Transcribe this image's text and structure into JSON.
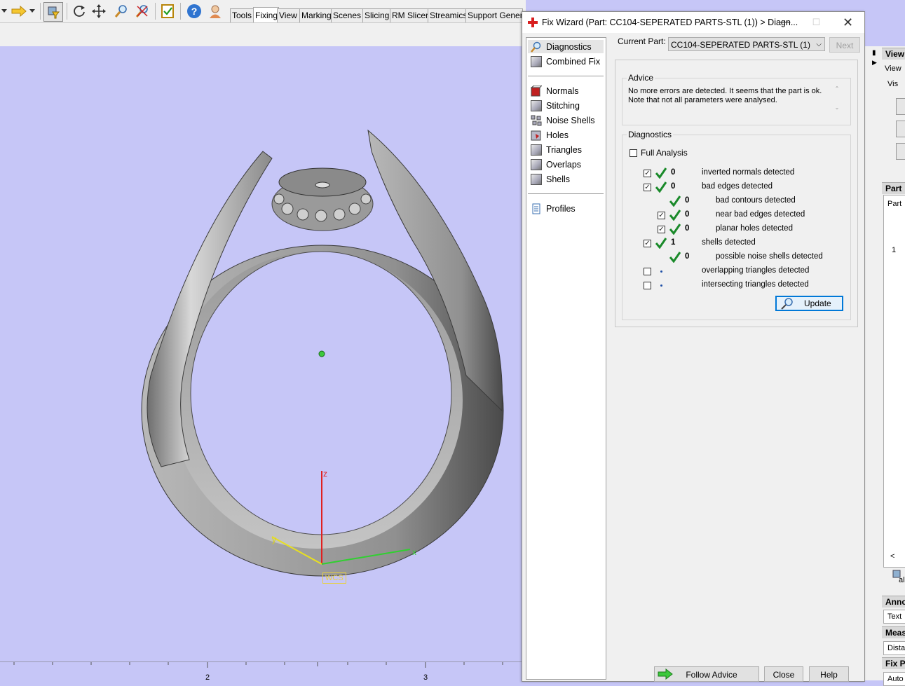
{
  "toolbar": {
    "tabs": [
      "Tools",
      "Fixing",
      "View",
      "Marking",
      "Scenes",
      "Slicing",
      "RM Slicer",
      "Streamics",
      "Support Generat"
    ],
    "active_tab": "Fixing"
  },
  "viewport": {
    "axes": {
      "z": "z",
      "y": "y",
      "x": "x"
    },
    "wcs_label": "WCS",
    "ruler_ticks": [
      "2",
      "3"
    ]
  },
  "wizard": {
    "title": "Fix Wizard (Part: CC104-SEPERATED PARTS-STL (1)) > Diagn...",
    "nav": {
      "primary": [
        "Diagnostics",
        "Combined Fix"
      ],
      "tools": [
        "Normals",
        "Stitching",
        "Noise Shells",
        "Holes",
        "Triangles",
        "Overlaps",
        "Shells"
      ],
      "profiles": "Profiles"
    },
    "current_part_label": "Current Part:",
    "current_part_value": "CC104-SEPERATED PARTS-STL (1)",
    "next_label": "Next",
    "advice": {
      "title": "Advice",
      "text": "No more errors are detected. It seems that the part is ok. Note that not all parameters were analysed."
    },
    "diagnostics": {
      "title": "Diagnostics",
      "full_analysis_label": "Full Analysis",
      "rows": [
        {
          "count": "0",
          "label": "inverted normals detected"
        },
        {
          "count": "0",
          "label": "bad edges detected"
        },
        {
          "count": "0",
          "label": "bad contours detected"
        },
        {
          "count": "0",
          "label": "near bad edges detected"
        },
        {
          "count": "0",
          "label": "planar holes detected"
        },
        {
          "count": "1",
          "label": "shells detected"
        },
        {
          "count": "0",
          "label": "possible noise shells detected"
        },
        {
          "count": "",
          "label": "overlapping triangles detected"
        },
        {
          "count": "",
          "label": "intersecting triangles detected"
        }
      ],
      "update_label": "Update"
    },
    "buttons": {
      "follow_advice": "Follow Advice",
      "close": "Close",
      "help": "Help"
    }
  },
  "right_panel": {
    "view_header": "View",
    "view_tab": "View",
    "vis_label": "Vis",
    "part_header": "Part",
    "part_tab": "Part",
    "row_number": "1",
    "scroll_left": "<",
    "al_label": "al",
    "anno_header": "Anno",
    "text_tab": "Text",
    "meas_header": "Meas",
    "dista_tab": "Dista",
    "fixpa_header": "Fix Pa",
    "auto_tab": "Auto"
  }
}
